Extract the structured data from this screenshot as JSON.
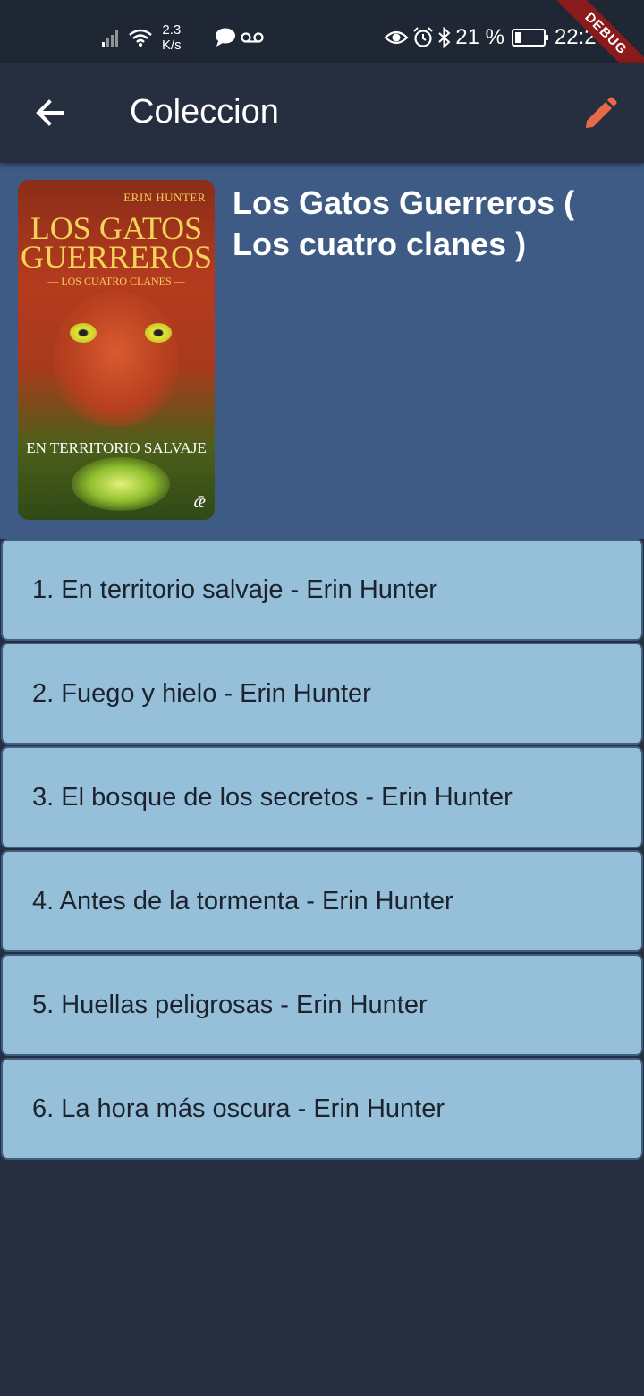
{
  "status_bar": {
    "net_speed_value": "2.3",
    "net_speed_unit": "K/s",
    "battery_percent": "21 %",
    "battery_level": 0.21,
    "time": "22:27",
    "icons": [
      "signal-icon",
      "wifi-icon",
      "chat-icon",
      "voicemail-icon",
      "eye-icon",
      "alarm-icon",
      "bluetooth-icon",
      "battery-icon"
    ]
  },
  "debug_banner": "DEBUG",
  "appbar": {
    "title": "Coleccion",
    "back_icon": "arrow-back-icon",
    "edit_icon": "pencil-icon",
    "edit_color": "#e8694a"
  },
  "collection": {
    "title": "Los Gatos Guerreros ( Los cuatro clanes )",
    "cover": {
      "author": "ERIN HUNTER",
      "title_line1": "LOS GATOS",
      "title_line2": "GUERREROS",
      "series": "— LOS CUATRO CLANES —",
      "subtitle": "EN TERRITORIO SALVAJE",
      "mark": "ǣ"
    }
  },
  "books": [
    "1. En territorio salvaje - Erin Hunter",
    "2. Fuego y hielo - Erin Hunter",
    "3. El bosque de los secretos - Erin Hunter",
    "4. Antes de la tormenta - Erin Hunter",
    "5. Huellas peligrosas - Erin Hunter",
    "6. La hora más oscura - Erin Hunter"
  ],
  "colors": {
    "background": "#262f3f",
    "header": "#3d5b84",
    "list_item": "#96bfda"
  }
}
